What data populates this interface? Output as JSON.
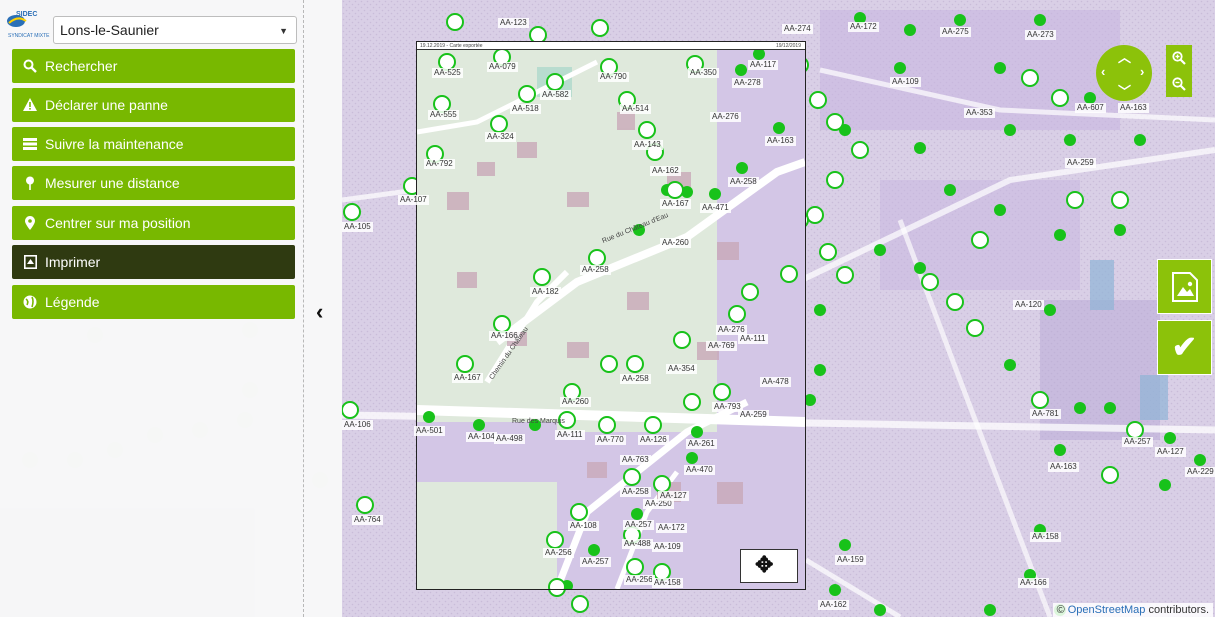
{
  "sidebar": {
    "logo_text": "SIDEC",
    "logo_subtext": "SYNDICAT MIXTE",
    "commune_select_value": "Lons-le-Saunier",
    "menu": [
      {
        "label": "Rechercher",
        "icon": "search-icon",
        "active": false
      },
      {
        "label": "Déclarer une panne",
        "icon": "warning-icon",
        "active": false
      },
      {
        "label": "Suivre la maintenance",
        "icon": "list-icon",
        "active": false
      },
      {
        "label": "Mesurer une distance",
        "icon": "pin-icon",
        "active": false
      },
      {
        "label": "Centrer sur ma position",
        "icon": "location-icon",
        "active": false
      },
      {
        "label": "Imprimer",
        "icon": "print-icon",
        "active": true
      },
      {
        "label": "Légende",
        "icon": "globe-icon",
        "active": false
      }
    ]
  },
  "print_frame": {
    "header_left": "19.12.2019 - Carte exportée",
    "header_right": "19/12/2019"
  },
  "map_labels": {
    "lamps": [
      "AA-525",
      "AA-079",
      "AA-790",
      "AA-350",
      "AA-117",
      "AA-278",
      "AA-555",
      "AA-518",
      "AA-582",
      "AA-514",
      "AA-276",
      "AA-324",
      "AA-143",
      "AA-163",
      "AA-792",
      "AA-162",
      "AA-258",
      "AA-107",
      "AA-167",
      "AA-471",
      "AA-260",
      "AA-258",
      "AA-182",
      "AA-166",
      "AA-276",
      "AA-111",
      "AA-769",
      "AA-167",
      "AA-354",
      "AA-478",
      "AA-260",
      "AA-258",
      "AA-501",
      "AA-104",
      "AA-498",
      "AA-111",
      "AA-770",
      "AA-126",
      "AA-793",
      "AA-259",
      "AA-261",
      "AA-763",
      "AA-470",
      "AA-258",
      "AA-250",
      "AA-127",
      "AA-108",
      "AA-257",
      "AA-172",
      "AA-488",
      "AA-109",
      "AA-256",
      "AA-257",
      "AA-256",
      "AA-158",
      "AA-123",
      "AA-274",
      "AA-172",
      "AA-275",
      "AA-273",
      "AA-109",
      "AA-353",
      "AA-163",
      "AA-607",
      "AA-259",
      "AA-781",
      "AA-163",
      "AA-257",
      "AA-229",
      "AA-127",
      "AA-158",
      "AA-166",
      "AA-162",
      "AA-159",
      "AA-764",
      "AA-106",
      "AA-105",
      "AA-120"
    ],
    "roads": [
      "Rue des Marquis",
      "Rue du Château d'Eau",
      "Chemin du Château"
    ]
  },
  "controls": {
    "zoom_in": "+",
    "zoom_out": "−",
    "validate": "✔"
  },
  "attribution": {
    "prefix": "©",
    "link": "OpenStreetMap",
    "suffix": "contributors."
  },
  "colors": {
    "accent": "#78b800",
    "active": "#2f3a11",
    "lamp": "#18c21a"
  }
}
